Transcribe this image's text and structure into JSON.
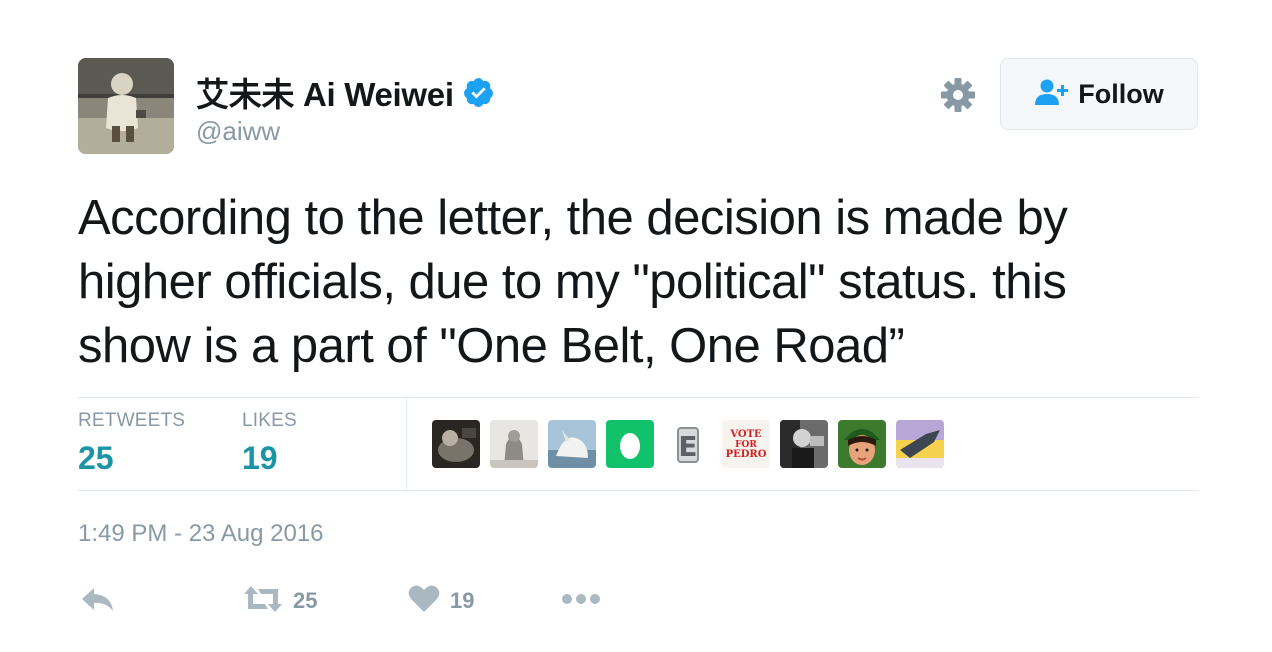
{
  "user": {
    "display_name": "艾未未 Ai Weiwei",
    "handle": "@aiww",
    "verified": true
  },
  "follow_button": {
    "label": "Follow"
  },
  "tweet": {
    "text": "According to the letter, the decision is made by higher officials, due to my \"political\" status. this show is a part of \"One Belt, One Road”",
    "timestamp": "1:49 PM - 23 Aug 2016"
  },
  "stats": {
    "retweets_label": "RETWEETS",
    "retweets_count": "25",
    "likes_label": "LIKES",
    "likes_count": "19"
  },
  "likers": [
    {
      "name": "liker-avatar-1"
    },
    {
      "name": "liker-avatar-2"
    },
    {
      "name": "liker-avatar-3"
    },
    {
      "name": "liker-avatar-4"
    },
    {
      "name": "liker-avatar-5",
      "text": "E"
    },
    {
      "name": "liker-avatar-6",
      "text_lines": [
        "VOTE",
        "FOR",
        "PEDRO"
      ]
    },
    {
      "name": "liker-avatar-7"
    },
    {
      "name": "liker-avatar-8"
    },
    {
      "name": "liker-avatar-9"
    }
  ],
  "actions": {
    "reply_icon": "reply-icon",
    "retweet_icon": "retweet-icon",
    "retweet_count": "25",
    "like_icon": "heart-icon",
    "like_count": "19",
    "more_icon": "more-icon"
  },
  "colors": {
    "verified_blue": "#1da1f2",
    "count_teal": "#1b95a5",
    "muted_gray": "#8899a6",
    "action_gray": "#aab8c2"
  }
}
